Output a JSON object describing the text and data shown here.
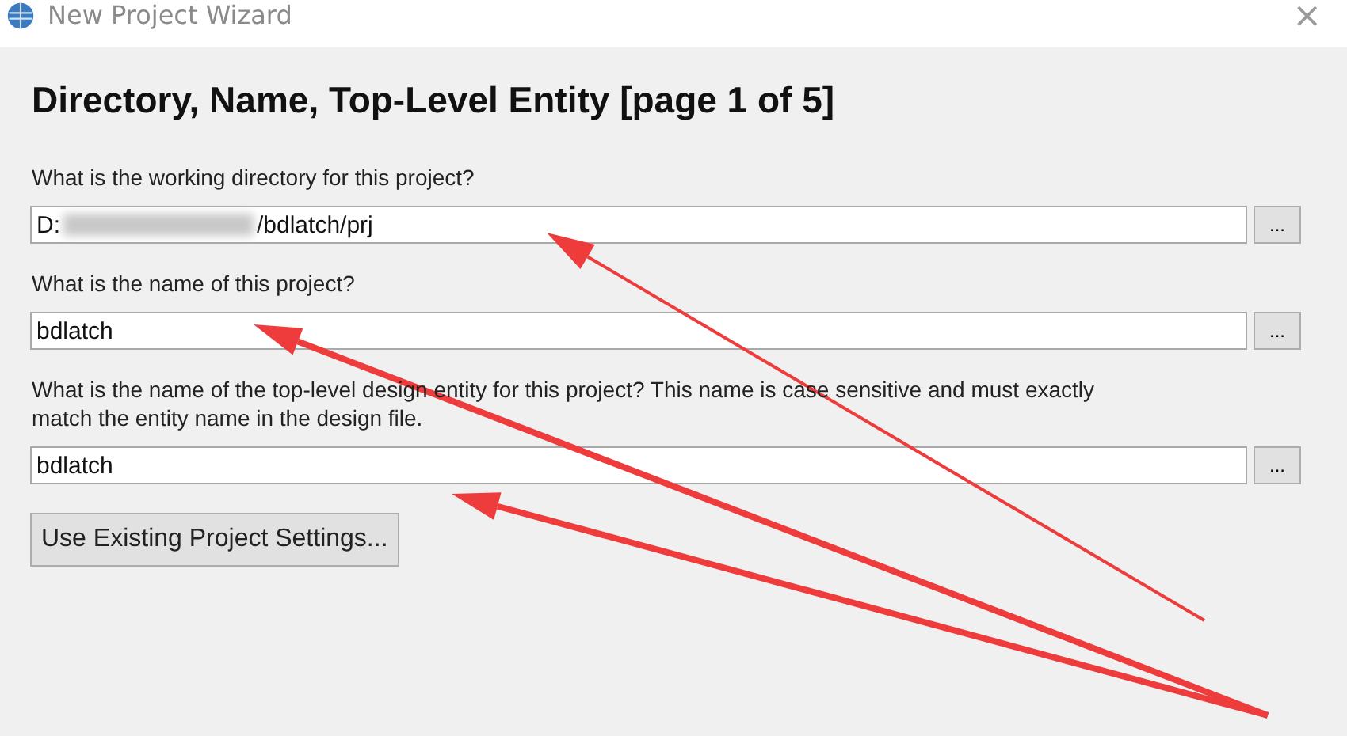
{
  "window": {
    "title": "New Project Wizard",
    "close": "×"
  },
  "heading": "Directory, Name, Top-Level Entity [page 1 of 5]",
  "fields": [
    {
      "label": "What is the working directory for this project?",
      "value_start": "D:",
      "value_end": "/bdlatch/prj",
      "redacted": true,
      "browse": "..."
    },
    {
      "label": "What is the name of this project?",
      "value_start": "bdlatch",
      "redacted": false,
      "browse": "..."
    },
    {
      "label": "What is the name of the top-level design entity for this project? This name is case sensitive and must exactly match the entity name in the design file.",
      "value_start": "bdlatch",
      "redacted": false,
      "browse": "..."
    }
  ],
  "button": "Use Existing Project Settings...",
  "annotations": [
    {
      "kind": "arrow"
    },
    {
      "kind": "arrow"
    },
    {
      "kind": "arrow"
    }
  ]
}
